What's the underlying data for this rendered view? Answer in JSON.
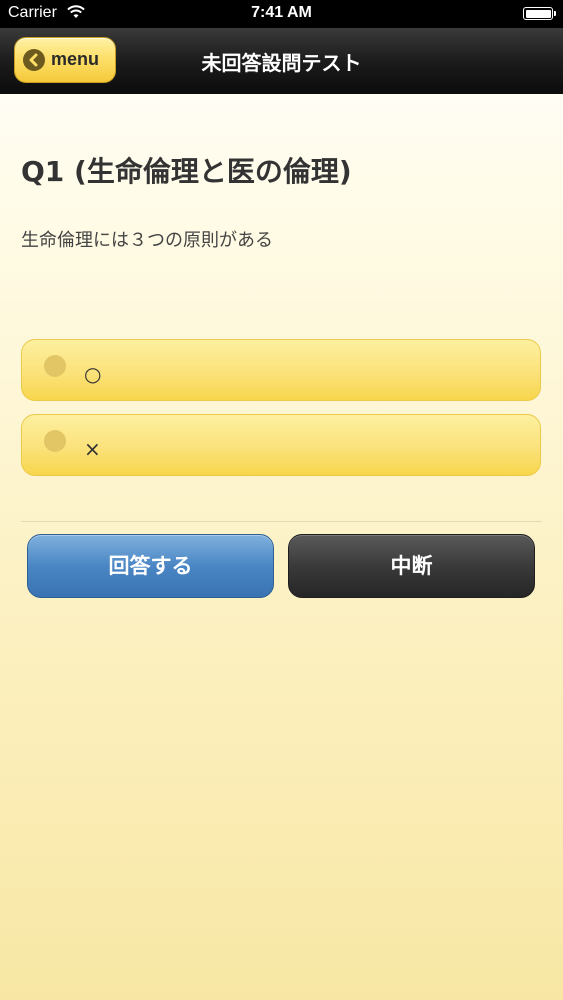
{
  "status_bar": {
    "carrier": "Carrier",
    "time": "7:41 AM"
  },
  "nav": {
    "menu_label": "menu",
    "title": "未回答設問テスト"
  },
  "question": {
    "title": "Q1 (生命倫理と医の倫理)",
    "body": "生命倫理には３つの原則がある"
  },
  "options": [
    {
      "label": "○"
    },
    {
      "label": "×"
    }
  ],
  "buttons": {
    "answer_label": "回答する",
    "pause_label": "中断"
  },
  "colors": {
    "accent_yellow": "#fde06a",
    "answer_blue": "#4a86c4",
    "pause_dark": "#3a3a3a"
  }
}
